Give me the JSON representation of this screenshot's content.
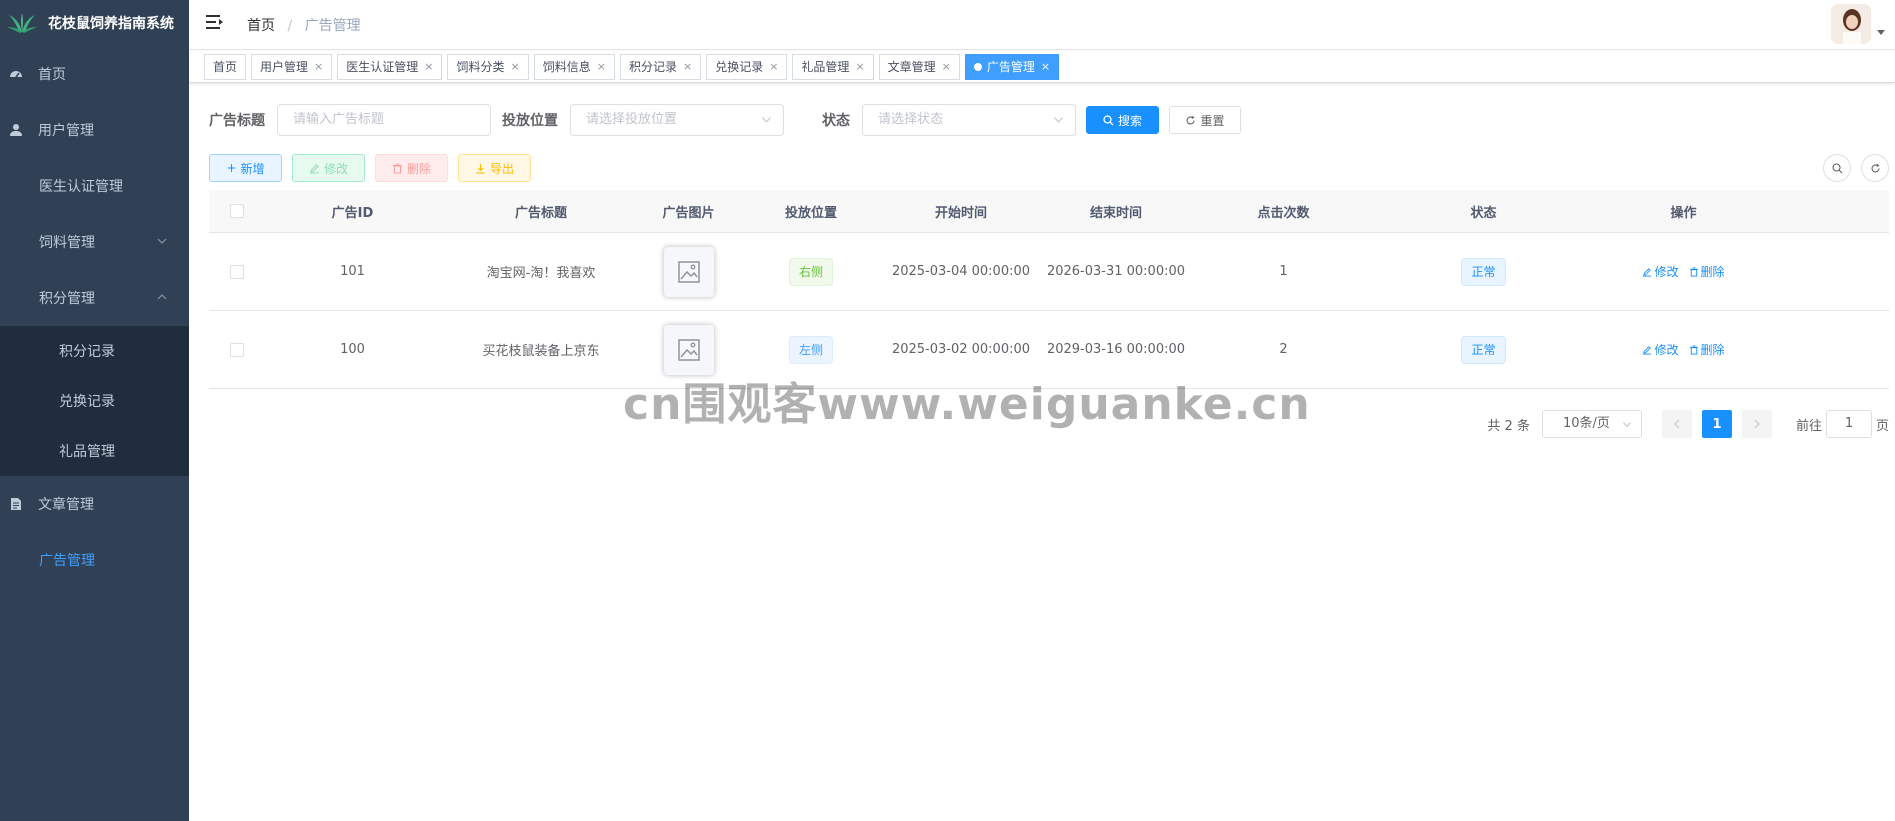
{
  "app": {
    "title": "花枝鼠饲养指南系统"
  },
  "sidebar": {
    "items": [
      {
        "label": "首页",
        "icon": "dashboard-icon"
      },
      {
        "label": "用户管理",
        "icon": "user-icon"
      },
      {
        "label": "医生认证管理"
      },
      {
        "label": "饲料管理",
        "expanded": false
      },
      {
        "label": "积分管理",
        "expanded": true,
        "children": [
          {
            "label": "积分记录"
          },
          {
            "label": "兑换记录"
          },
          {
            "label": "礼品管理"
          }
        ]
      },
      {
        "label": "文章管理",
        "icon": "document-icon"
      },
      {
        "label": "广告管理",
        "active": true
      }
    ]
  },
  "breadcrumb": {
    "home": "首页",
    "separator": "/",
    "current": "广告管理"
  },
  "tags": [
    {
      "label": "首页",
      "closable": false
    },
    {
      "label": "用户管理",
      "closable": true
    },
    {
      "label": "医生认证管理",
      "closable": true
    },
    {
      "label": "饲料分类",
      "closable": true
    },
    {
      "label": "饲料信息",
      "closable": true
    },
    {
      "label": "积分记录",
      "closable": true
    },
    {
      "label": "兑换记录",
      "closable": true
    },
    {
      "label": "礼品管理",
      "closable": true
    },
    {
      "label": "文章管理",
      "closable": true
    },
    {
      "label": "广告管理",
      "closable": true,
      "active": true
    }
  ],
  "tag_close_glyph": "×",
  "search": {
    "title_label": "广告标题",
    "title_placeholder": "请输入广告标题",
    "position_label": "投放位置",
    "position_placeholder": "请选择投放位置",
    "status_label": "状态",
    "status_placeholder": "请选择状态",
    "search_button": "搜索",
    "reset_button": "重置"
  },
  "toolbar": {
    "add": "新增",
    "edit": "修改",
    "delete": "删除",
    "export": "导出"
  },
  "table": {
    "columns": [
      "广告ID",
      "广告标题",
      "广告图片",
      "投放位置",
      "开始时间",
      "结束时间",
      "点击次数",
      "状态",
      "操作"
    ],
    "rows": [
      {
        "id": "101",
        "title": "淘宝网-淘！我喜欢",
        "position": "右侧",
        "position_type": "right",
        "start": "2025-03-04 00:00:00",
        "end": "2026-03-31 00:00:00",
        "clicks": "1",
        "status": "正常"
      },
      {
        "id": "100",
        "title": "买花枝鼠装备上京东",
        "position": "左侧",
        "position_type": "left",
        "start": "2025-03-02 00:00:00",
        "end": "2029-03-16 00:00:00",
        "clicks": "2",
        "status": "正常"
      }
    ],
    "op_edit": "修改",
    "op_delete": "删除"
  },
  "pagination": {
    "total_text": "共 2 条",
    "page_size": "10条/页",
    "current_page": "1",
    "goto_label": "前往",
    "goto_value": "1",
    "page_suffix": "页"
  },
  "watermark": "cn围观客www.weiguanke.cn",
  "colors": {
    "sidebar_bg": "#304156",
    "submenu_bg": "#1f2d3d",
    "primary": "#1890ff",
    "active_menu": "#409eff"
  }
}
